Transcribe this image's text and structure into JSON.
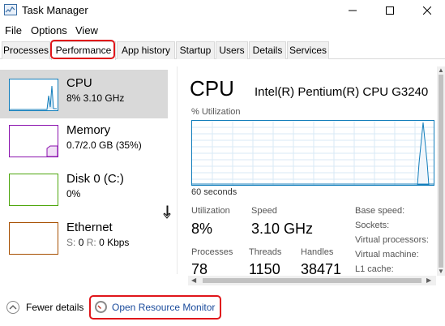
{
  "window": {
    "title": "Task Manager",
    "controls": [
      "minimize",
      "maximize",
      "close"
    ]
  },
  "menu": [
    "File",
    "Options",
    "View"
  ],
  "tabs": [
    {
      "label": "Processes",
      "active": false
    },
    {
      "label": "Performance",
      "active": true
    },
    {
      "label": "App history",
      "active": false
    },
    {
      "label": "Startup",
      "active": false
    },
    {
      "label": "Users",
      "active": false
    },
    {
      "label": "Details",
      "active": false
    },
    {
      "label": "Services",
      "active": false
    }
  ],
  "sidebar": {
    "items": [
      {
        "name": "CPU",
        "detail": "8%  3.10 GHz",
        "color": "#117dbb",
        "selected": true
      },
      {
        "name": "Memory",
        "detail": "0.7/2.0 GB (35%)",
        "color": "#8b12ae",
        "selected": false
      },
      {
        "name": "Disk 0 (C:)",
        "detail": "0%",
        "color": "#4da60c",
        "selected": false
      },
      {
        "name": "Ethernet",
        "detail_prefix_send": "S:",
        "send": "0",
        "detail_prefix_recv": "R:",
        "recv": "0 Kbps",
        "color": "#a74f01",
        "selected": false
      }
    ]
  },
  "main": {
    "title": "CPU",
    "model": "Intel(R) Pentium(R) CPU G3240",
    "graph_label": "% Utilization",
    "time_label": "60 seconds",
    "stats": {
      "utilization_label": "Utilization",
      "utilization_value": "8%",
      "speed_label": "Speed",
      "speed_value": "3.10 GHz",
      "processes_label": "Processes",
      "processes_value": "78",
      "threads_label": "Threads",
      "threads_value": "1150",
      "handles_label": "Handles",
      "handles_value": "38471"
    },
    "info_labels": [
      "Base speed:",
      "Sockets:",
      "Virtual processors:",
      "Virtual machine:",
      "L1 cache:"
    ]
  },
  "footer": {
    "fewer_details": "Fewer details",
    "open_resource_monitor": "Open Resource Monitor"
  },
  "colors": {
    "cpu_accent": "#117dbb",
    "highlight_ring": "#e0151a",
    "link": "#1a4b9c"
  }
}
